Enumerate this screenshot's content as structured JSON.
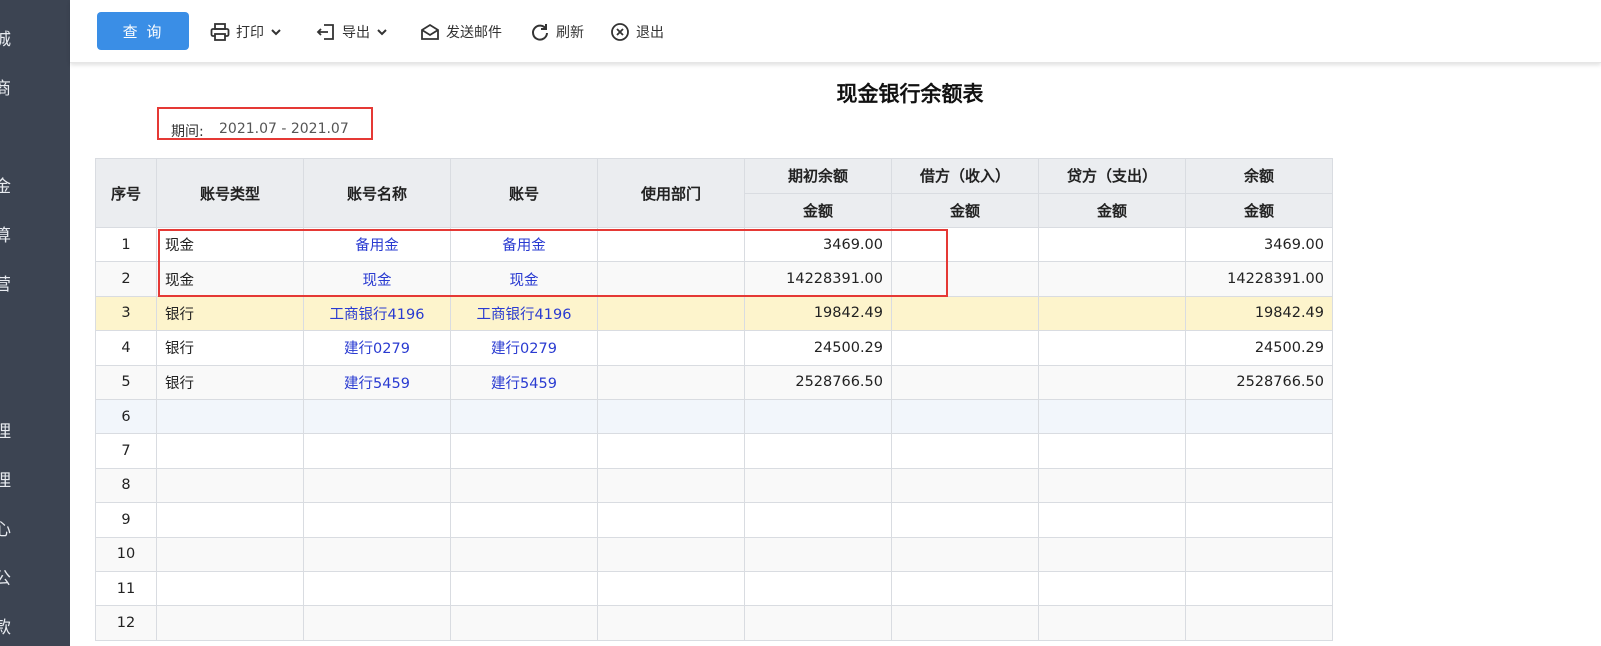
{
  "sidebar": {
    "items": [
      "城",
      "商",
      "金",
      "算",
      "营",
      "理",
      "理",
      "心",
      "公",
      "款"
    ]
  },
  "toolbar": {
    "query_label": "查 询",
    "print_label": "打印",
    "export_label": "导出",
    "send_mail_label": "发送邮件",
    "refresh_label": "刷新",
    "exit_label": "退出"
  },
  "report": {
    "title": "现金银行余额表",
    "period_label": "期间:",
    "period_value": "2021.07 - 2021.07"
  },
  "table": {
    "headers": {
      "no": "序号",
      "type": "账号类型",
      "name": "账号名称",
      "account": "账号",
      "dept": "使用部门",
      "opening": "期初余额",
      "debit": "借方（收入）",
      "credit": "贷方（支出）",
      "balance": "余额",
      "amount": "金额"
    },
    "rows": [
      {
        "no": "1",
        "type": "现金",
        "name": "备用金",
        "account": "备用金",
        "dept": "",
        "opening": "3469.00",
        "debit": "",
        "credit": "",
        "balance": "3469.00"
      },
      {
        "no": "2",
        "type": "现金",
        "name": "现金",
        "account": "现金",
        "dept": "",
        "opening": "14228391.00",
        "debit": "",
        "credit": "",
        "balance": "14228391.00"
      },
      {
        "no": "3",
        "type": "银行",
        "name": "工商银行4196",
        "account": "工商银行4196",
        "dept": "",
        "opening": "19842.49",
        "debit": "",
        "credit": "",
        "balance": "19842.49"
      },
      {
        "no": "4",
        "type": "银行",
        "name": "建行0279",
        "account": "建行0279",
        "dept": "",
        "opening": "24500.29",
        "debit": "",
        "credit": "",
        "balance": "24500.29"
      },
      {
        "no": "5",
        "type": "银行",
        "name": "建行5459",
        "account": "建行5459",
        "dept": "",
        "opening": "2528766.50",
        "debit": "",
        "credit": "",
        "balance": "2528766.50"
      },
      {
        "no": "6",
        "type": "",
        "name": "",
        "account": "",
        "dept": "",
        "opening": "",
        "debit": "",
        "credit": "",
        "balance": ""
      },
      {
        "no": "7",
        "type": "",
        "name": "",
        "account": "",
        "dept": "",
        "opening": "",
        "debit": "",
        "credit": "",
        "balance": ""
      },
      {
        "no": "8",
        "type": "",
        "name": "",
        "account": "",
        "dept": "",
        "opening": "",
        "debit": "",
        "credit": "",
        "balance": ""
      },
      {
        "no": "9",
        "type": "",
        "name": "",
        "account": "",
        "dept": "",
        "opening": "",
        "debit": "",
        "credit": "",
        "balance": ""
      },
      {
        "no": "10",
        "type": "",
        "name": "",
        "account": "",
        "dept": "",
        "opening": "",
        "debit": "",
        "credit": "",
        "balance": ""
      },
      {
        "no": "11",
        "type": "",
        "name": "",
        "account": "",
        "dept": "",
        "opening": "",
        "debit": "",
        "credit": "",
        "balance": ""
      },
      {
        "no": "12",
        "type": "",
        "name": "",
        "account": "",
        "dept": "",
        "opening": "",
        "debit": "",
        "credit": "",
        "balance": ""
      }
    ]
  },
  "colors": {
    "primary": "#3a8ee6",
    "highlight_row": "#fdf4cc",
    "link": "#2a3bd1",
    "annotation_red": "#e53935",
    "sidebar_bg": "#3c4452"
  }
}
